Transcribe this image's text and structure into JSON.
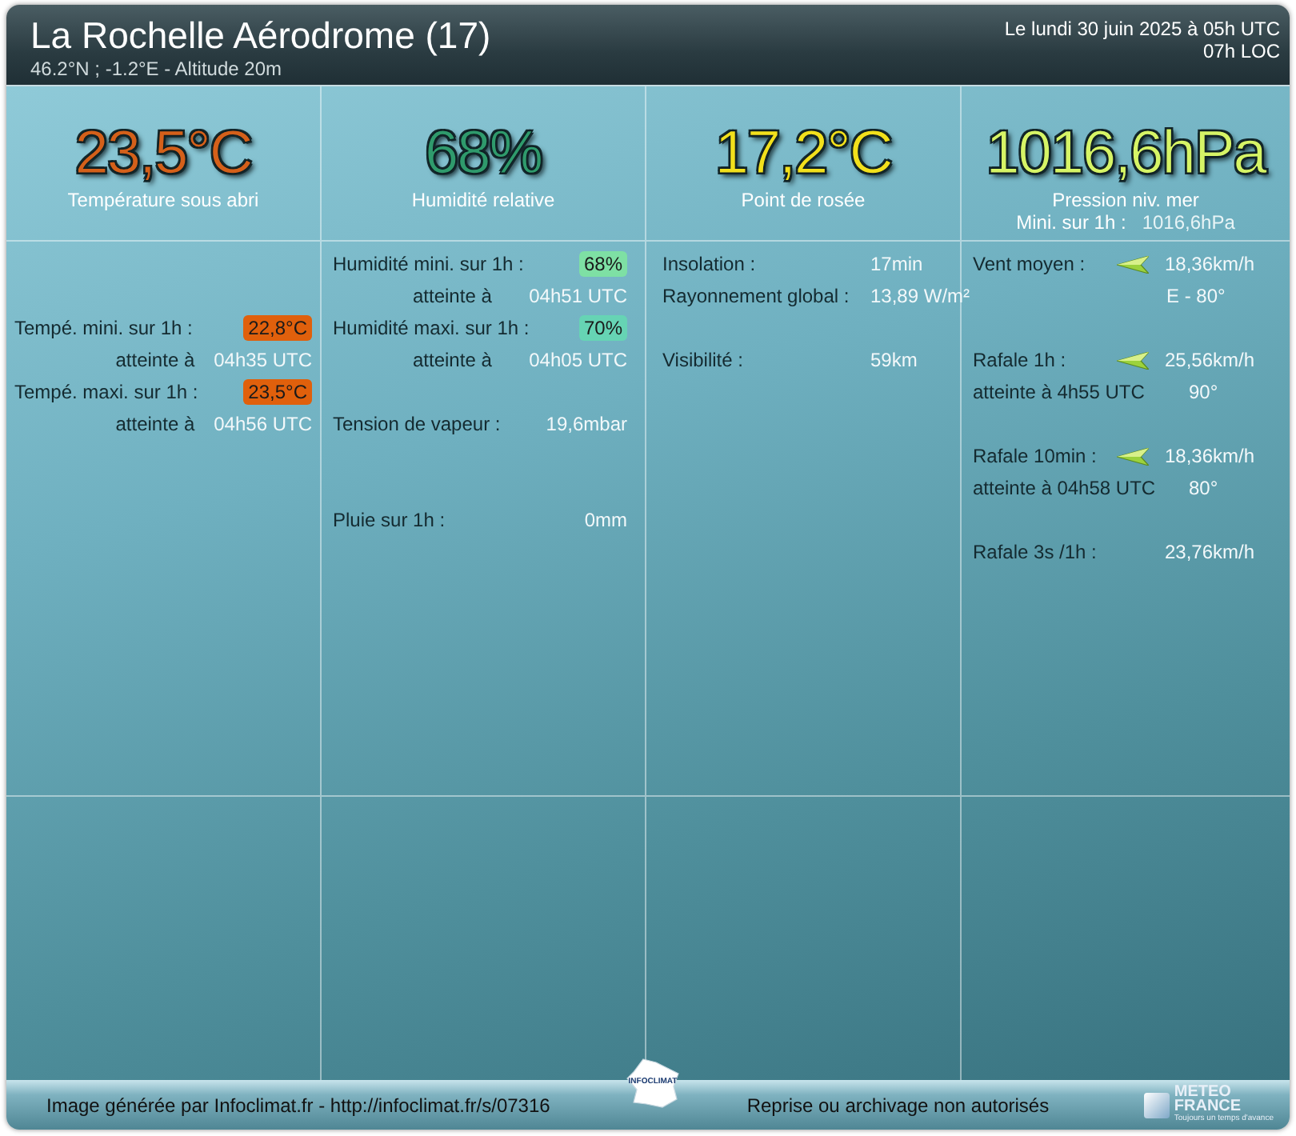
{
  "header": {
    "title": "La Rochelle Aérodrome (17)",
    "coords": "46.2°N ; -1.2°E - Altitude 20m",
    "date": "Le lundi 30 juin 2025 à 05h UTC",
    "local_time": "07h LOC"
  },
  "main": [
    {
      "value": "23,5°C",
      "label": "Température sous abri",
      "color": "#d4601a"
    },
    {
      "value": "68%",
      "label": "Humidité relative",
      "color": "#2f9a6c"
    },
    {
      "value": "17,2°C",
      "label": "Point de rosée",
      "color": "#f2e01c"
    },
    {
      "value": "1016,6hPa",
      "label": "Pression niv. mer",
      "color": "#d6f466",
      "sub_label": "Mini. sur 1h :",
      "sub_value": "1016,6hPa"
    }
  ],
  "columns": [
    [
      {
        "kind": "blank"
      },
      {
        "kind": "blank"
      },
      {
        "kind": "measure",
        "label": "Tempé. mini. sur 1h :",
        "value": "22,8°C",
        "color": "#e0600c"
      },
      {
        "kind": "reached",
        "label": "atteinte à",
        "value": "04h35 UTC"
      },
      {
        "kind": "measure",
        "label": "Tempé. maxi. sur 1h :",
        "value": "23,5°C",
        "color": "#e0600c"
      },
      {
        "kind": "reached",
        "label": "atteinte à",
        "value": "04h56 UTC"
      }
    ],
    [
      {
        "kind": "measure",
        "label": "Humidité mini. sur 1h :",
        "value": "68%",
        "color": "#7ee0a4"
      },
      {
        "kind": "reached",
        "label": "atteinte à",
        "value": "04h51 UTC"
      },
      {
        "kind": "measure",
        "label": "Humidité maxi. sur 1h :",
        "value": "70%",
        "color": "#66d4b4"
      },
      {
        "kind": "reached",
        "label": "atteinte à",
        "value": "04h05 UTC"
      },
      {
        "kind": "blank"
      },
      {
        "kind": "measure",
        "label": "Tension de vapeur :",
        "value": "19,6mbar"
      },
      {
        "kind": "blank"
      },
      {
        "kind": "blank"
      },
      {
        "kind": "measure",
        "label": "Pluie sur 1h :",
        "value": "0mm"
      }
    ],
    [
      {
        "kind": "measure",
        "label": "Insolation :",
        "value": "17min"
      },
      {
        "kind": "measure",
        "label": "Rayonnement global :",
        "value": "13,89 W/m²"
      },
      {
        "kind": "blank"
      },
      {
        "kind": "measure",
        "label": "Visibilité :",
        "value": "59km"
      }
    ],
    [
      {
        "kind": "wind",
        "label": "Vent moyen :",
        "value": "18,36km/h"
      },
      {
        "kind": "note",
        "value": "E - 80°"
      },
      {
        "kind": "blank"
      },
      {
        "kind": "wind",
        "label": "Rafale 1h :",
        "value": "25,56km/h"
      },
      {
        "kind": "note",
        "label": "atteinte à 4h55 UTC",
        "value": "90°"
      },
      {
        "kind": "blank"
      },
      {
        "kind": "wind",
        "label": "Rafale 10min :",
        "value": "18,36km/h"
      },
      {
        "kind": "note",
        "label": "atteinte à 04h58 UTC",
        "value": "80°"
      },
      {
        "kind": "blank"
      },
      {
        "kind": "measure",
        "label": "Rafale 3s /1h :",
        "value": "23,76km/h"
      }
    ]
  ],
  "footer": {
    "credit": "Image générée par Infoclimat.fr - http://infoclimat.fr/s/07316",
    "notice": "Reprise ou archivage non autorisés",
    "center_logo": "INFOCLIMAT",
    "logo_top": "METEO",
    "logo_bottom": "FRANCE",
    "logo_tagline": "Toujours un temps d'avance"
  }
}
